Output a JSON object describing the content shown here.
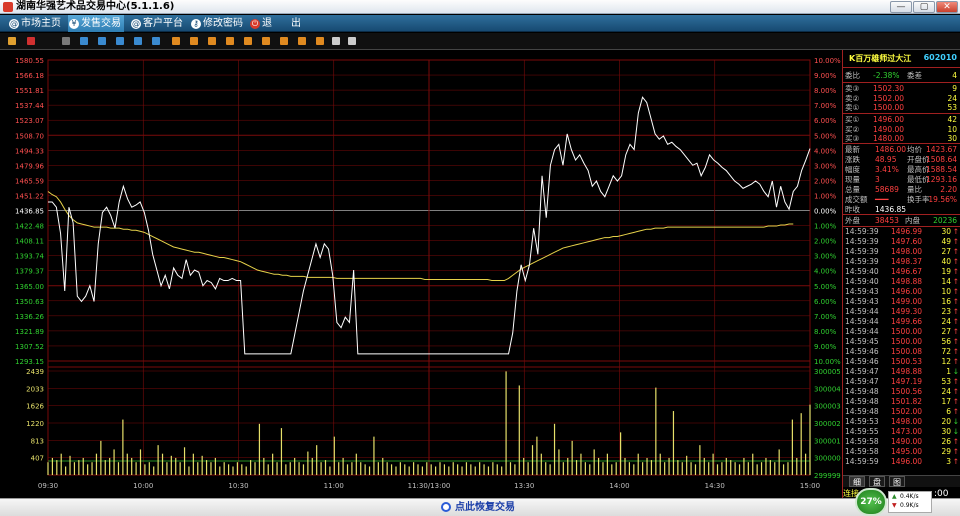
{
  "window": {
    "title": "湖南华强艺术品交易中心(5.1.1.6)",
    "min": "—",
    "max": "▢",
    "close": "✕"
  },
  "menu": [
    {
      "label": "市场主页",
      "icon": "globe-icon"
    },
    {
      "label": "发售交易",
      "icon": "yen-icon"
    },
    {
      "label": "客户平台",
      "icon": "globe-icon"
    },
    {
      "label": "修改密码",
      "icon": "key-icon"
    },
    {
      "label": "退",
      "icon": "power-icon"
    },
    {
      "label": "出",
      "icon": ""
    }
  ],
  "chart_data": {
    "type": "line",
    "price_axis": [
      "1580.55",
      "1566.18",
      "1551.81",
      "1537.44",
      "1523.07",
      "1508.70",
      "1494.33",
      "1479.96",
      "1465.59",
      "1451.22",
      "1436.85",
      "1422.48",
      "1408.11",
      "1393.74",
      "1379.37",
      "1365.00",
      "1350.63",
      "1336.26",
      "1321.89",
      "1307.52",
      "1293.15"
    ],
    "pct_axis": [
      "10.00%",
      "9.00%",
      "8.00%",
      "7.00%",
      "6.00%",
      "5.00%",
      "4.00%",
      "3.00%",
      "2.00%",
      "1.00%",
      "0.00%",
      "1.00%",
      "2.00%",
      "3.00%",
      "4.00%",
      "5.00%",
      "6.00%",
      "7.00%",
      "8.00%",
      "9.00%",
      "10.00%"
    ],
    "volume_axis_left": [
      "2439",
      "2033",
      "1626",
      "1220",
      "813",
      "407"
    ],
    "volume_axis_right": [
      "300005",
      "300004",
      "300003",
      "300002",
      "300001",
      "300000",
      "299999"
    ],
    "time_axis": [
      "09:30",
      "10:00",
      "10:30",
      "11:00",
      "11:30/13:00",
      "13:30",
      "14:00",
      "14:30",
      "15:00"
    ],
    "price_range": [
      1293.15,
      1580.55
    ],
    "prev_close": 1436.85,
    "volume_max": 2439,
    "price_series": [
      1445,
      1445,
      1440,
      1415,
      1360,
      1440,
      1425,
      1355,
      1350,
      1355,
      1365,
      1350,
      1405,
      1435,
      1440,
      1432,
      1420,
      1445,
      1460,
      1448,
      1440,
      1442,
      1445,
      1435,
      1418,
      1395,
      1380,
      1365,
      1375,
      1362,
      1382,
      1375,
      1372,
      1390,
      1375,
      1380,
      1378,
      1365,
      1370,
      1368,
      1362,
      1372,
      1370,
      1370,
      1372,
      1370,
      1370,
      1300,
      1300,
      1300,
      1300,
      1300,
      1300,
      1300,
      1300,
      1300,
      1300,
      1300,
      1300,
      1320,
      1340,
      1360,
      1375,
      1390,
      1405,
      1392,
      1405,
      1400,
      1375,
      1330,
      1325,
      1335,
      1330,
      1380,
      1300,
      1300,
      1300,
      1300,
      1300,
      1300,
      1300,
      1300,
      1300,
      1300,
      1300,
      1300,
      1300,
      1300,
      1300,
      1300,
      1300,
      1300,
      1300,
      1300,
      1300,
      1300,
      1300,
      1300,
      1300,
      1300,
      1300,
      1300,
      1300,
      1300,
      1300,
      1300,
      1300,
      1300,
      1300,
      1300,
      1300,
      1320,
      1360,
      1385,
      1370,
      1385,
      1420,
      1395,
      1470,
      1430,
      1480,
      1495,
      1500,
      1480,
      1510,
      1495,
      1485,
      1490,
      1482,
      1475,
      1460,
      1465,
      1455,
      1450,
      1460,
      1470,
      1465,
      1470,
      1490,
      1500,
      1495,
      1530,
      1545,
      1540,
      1525,
      1510,
      1505,
      1508,
      1500,
      1502,
      1498,
      1495,
      1490,
      1485,
      1480,
      1482,
      1470,
      1478,
      1490,
      1485,
      1482,
      1478,
      1475,
      1470,
      1465,
      1462,
      1458,
      1460,
      1462,
      1465,
      1462,
      1455,
      1450,
      1465,
      1440,
      1460,
      1445,
      1438,
      1455,
      1460,
      1475,
      1485,
      1496
    ],
    "avg_series": [
      1455,
      1452,
      1450,
      1445,
      1438,
      1432,
      1428,
      1425,
      1424,
      1423,
      1422,
      1421,
      1421,
      1421,
      1421,
      1420,
      1420,
      1420,
      1419,
      1419,
      1418,
      1418,
      1417,
      1416,
      1414,
      1412,
      1410,
      1408,
      1406,
      1404,
      1402,
      1401,
      1400,
      1399,
      1398,
      1397,
      1397,
      1396,
      1395,
      1394,
      1393,
      1392,
      1392,
      1391,
      1390,
      1389,
      1388,
      1386,
      1384,
      1382,
      1380,
      1379,
      1378,
      1377,
      1376,
      1376,
      1375,
      1375,
      1374,
      1374,
      1374,
      1374,
      1373,
      1373,
      1373,
      1373,
      1373,
      1373,
      1373,
      1372,
      1372,
      1372,
      1372,
      1372,
      1372,
      1372,
      1372,
      1372,
      1372,
      1372,
      1372,
      1372,
      1372,
      1372,
      1372,
      1372,
      1372,
      1372,
      1372,
      1372,
      1371,
      1371,
      1371,
      1371,
      1371,
      1371,
      1371,
      1371,
      1371,
      1371,
      1371,
      1371,
      1371,
      1371,
      1371,
      1371,
      1370,
      1370,
      1370,
      1370,
      1372,
      1375,
      1378,
      1381,
      1383,
      1385,
      1387,
      1389,
      1391,
      1393,
      1395,
      1397,
      1399,
      1401,
      1402,
      1403,
      1404,
      1405,
      1406,
      1407,
      1408,
      1409,
      1410,
      1411,
      1411,
      1412,
      1412,
      1413,
      1414,
      1415,
      1416,
      1417,
      1418,
      1419,
      1419,
      1420,
      1420,
      1420,
      1421,
      1421,
      1421,
      1421,
      1421,
      1421,
      1421,
      1421,
      1421,
      1421,
      1421,
      1421,
      1421,
      1421,
      1421,
      1421,
      1421,
      1421,
      1421,
      1421,
      1421,
      1421,
      1421,
      1421,
      1422,
      1422,
      1422,
      1423,
      1423,
      1424,
      1424
    ],
    "volume_series": [
      300,
      400,
      350,
      500,
      200,
      450,
      300,
      350,
      400,
      250,
      300,
      500,
      800,
      350,
      400,
      600,
      300,
      1300,
      500,
      400,
      300,
      600,
      250,
      300,
      200,
      700,
      500,
      300,
      450,
      400,
      300,
      650,
      200,
      500,
      300,
      450,
      350,
      300,
      400,
      200,
      300,
      250,
      200,
      300,
      250,
      200,
      350,
      300,
      1200,
      400,
      250,
      500,
      300,
      1100,
      250,
      300,
      400,
      300,
      250,
      550,
      400,
      700,
      300,
      350,
      200,
      900,
      300,
      400,
      250,
      300,
      500,
      300,
      250,
      200,
      900,
      300,
      400,
      300,
      250,
      200,
      300,
      250,
      200,
      300,
      250,
      200,
      300,
      250,
      200,
      300,
      250,
      200,
      300,
      250,
      200,
      300,
      250,
      200,
      300,
      250,
      200,
      300,
      250,
      200,
      2430,
      300,
      250,
      2100,
      400,
      300,
      700,
      900,
      500,
      300,
      250,
      1200,
      600,
      300,
      400,
      800,
      350,
      500,
      300,
      250,
      600,
      400,
      300,
      500,
      250,
      300,
      1000,
      400,
      300,
      250,
      500,
      300,
      400,
      350,
      2050,
      500,
      300,
      400,
      1500,
      350,
      300,
      450,
      300,
      250,
      700,
      400,
      300,
      500,
      250,
      300,
      400,
      350,
      300,
      250,
      400,
      300,
      500,
      250,
      300,
      400,
      350,
      300,
      600,
      250,
      300,
      1300,
      400,
      1450,
      500,
      1650
    ]
  },
  "panel": {
    "stock_name": "K百万雄师过大江",
    "stock_code": "602010",
    "weibi_label": "委比",
    "weibi_value": "-2.38%",
    "weicha_label": "委差",
    "weicha_value": "4",
    "sells": [
      {
        "label": "卖③",
        "price": "1502.30",
        "vol": "9"
      },
      {
        "label": "卖②",
        "price": "1502.00",
        "vol": "24"
      },
      {
        "label": "卖①",
        "price": "1500.00",
        "vol": "53"
      }
    ],
    "buys": [
      {
        "label": "买①",
        "price": "1496.00",
        "vol": "42"
      },
      {
        "label": "买②",
        "price": "1490.00",
        "vol": "10"
      },
      {
        "label": "买③",
        "price": "1480.00",
        "vol": "30"
      }
    ],
    "stats": [
      {
        "l1": "最新",
        "v1": "1486.00",
        "l2": "均价",
        "v2": "1423.67"
      },
      {
        "l1": "涨跌",
        "v1": "48.95",
        "l2": "开盘价",
        "v2": "1508.64"
      },
      {
        "l1": "幅度",
        "v1": "3.41%",
        "l2": "最高价",
        "v2": "1588.54"
      },
      {
        "l1": "现量",
        "v1": "3",
        "l2": "最低价",
        "v2": "1293.16"
      },
      {
        "l1": "总量",
        "v1": "58689",
        "l2": "量比",
        "v2": "2.20"
      },
      {
        "l1": "成交额",
        "v1": "━━━",
        "l2": "换手率",
        "v2": "19.56%"
      },
      {
        "l1": "昨收",
        "v1": "1436.85",
        "l2": "",
        "v2": ""
      }
    ],
    "outer_label": "外盘",
    "outer_value": "38453",
    "inner_label": "内盘",
    "inner_value": "20236",
    "ticks": [
      {
        "t": "14:59:39",
        "p": "1496.99",
        "v": "30",
        "d": "↑"
      },
      {
        "t": "14:59:39",
        "p": "1497.60",
        "v": "49",
        "d": "↑"
      },
      {
        "t": "14:59:39",
        "p": "1498.00",
        "v": "27",
        "d": "↑"
      },
      {
        "t": "14:59:39",
        "p": "1498.37",
        "v": "40",
        "d": "↑"
      },
      {
        "t": "14:59:40",
        "p": "1496.67",
        "v": "19",
        "d": "↑"
      },
      {
        "t": "14:59:40",
        "p": "1498.88",
        "v": "14",
        "d": "↑"
      },
      {
        "t": "14:59:43",
        "p": "1496.00",
        "v": "10",
        "d": "↑"
      },
      {
        "t": "14:59:43",
        "p": "1499.00",
        "v": "16",
        "d": "↑"
      },
      {
        "t": "14:59:44",
        "p": "1499.30",
        "v": "23",
        "d": "↑"
      },
      {
        "t": "14:59:44",
        "p": "1499.66",
        "v": "24",
        "d": "↑"
      },
      {
        "t": "14:59:44",
        "p": "1500.00",
        "v": "27",
        "d": "↑"
      },
      {
        "t": "14:59:45",
        "p": "1500.00",
        "v": "56",
        "d": "↑"
      },
      {
        "t": "14:59:46",
        "p": "1500.08",
        "v": "72",
        "d": "↑"
      },
      {
        "t": "14:59:46",
        "p": "1500.53",
        "v": "12",
        "d": "↑"
      },
      {
        "t": "14:59:47",
        "p": "1498.88",
        "v": "1",
        "d": "↓"
      },
      {
        "t": "14:59:47",
        "p": "1497.19",
        "v": "53",
        "d": "↑"
      },
      {
        "t": "14:59:48",
        "p": "1500.56",
        "v": "24",
        "d": "↑"
      },
      {
        "t": "14:59:48",
        "p": "1501.82",
        "v": "17",
        "d": "↑"
      },
      {
        "t": "14:59:48",
        "p": "1502.00",
        "v": "6",
        "d": "↑"
      },
      {
        "t": "14:59:53",
        "p": "1498.00",
        "v": "20",
        "d": "↓"
      },
      {
        "t": "14:59:55",
        "p": "1473.00",
        "v": "30",
        "d": "↓"
      },
      {
        "t": "14:59:58",
        "p": "1490.00",
        "v": "26",
        "d": "↑"
      },
      {
        "t": "14:59:58",
        "p": "1495.00",
        "v": "29",
        "d": "↑"
      },
      {
        "t": "14:59:59",
        "p": "1496.00",
        "v": "3",
        "d": "↑"
      }
    ],
    "tabs": [
      "细",
      "盘",
      "图"
    ],
    "connect_label": "连接"
  },
  "status": {
    "message": "点此恢复交易",
    "gauge": "27%",
    "up_speed": "0.4K/s",
    "down_speed": "0.9K/s",
    "clock": ":00"
  },
  "colors": {
    "grid": "#7a0a0a",
    "price_line": "#ffffff",
    "avg_line": "#e6d24a",
    "up": "#ff4040",
    "down": "#38d838",
    "axis_text_up": "#ff5050",
    "axis_text_down": "#30d030",
    "volume_bar": "#e6e06a"
  }
}
